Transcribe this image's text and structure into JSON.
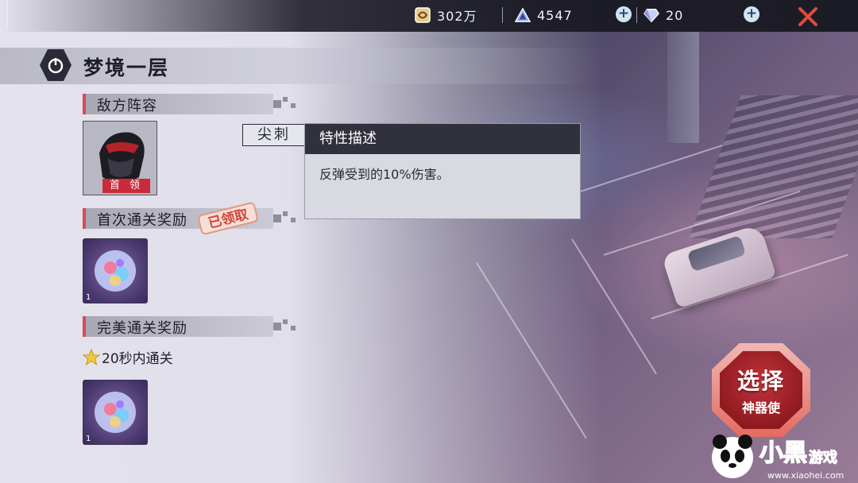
{
  "resources": {
    "gold": {
      "value": "302万",
      "icon": "coin-icon"
    },
    "energy": {
      "value": "4547",
      "icon": "energy-triangle-icon"
    },
    "diamond": {
      "value": "20",
      "icon": "diamond-icon"
    }
  },
  "title": "梦境一层",
  "sections": {
    "enemy": "敌方阵容",
    "first_clear": "首次通关奖励",
    "perfect_clear": "完美通关奖励"
  },
  "enemy": {
    "tag": "首 领"
  },
  "claimed_stamp": "已领取",
  "rewards": {
    "first_clear_count": "1",
    "perfect_clear_count": "1"
  },
  "perfect_condition": "20秒内通关",
  "trait": {
    "label": "尖刺"
  },
  "popup": {
    "title": "特性描述",
    "description": "反弹受到的10%伤害。"
  },
  "select_button": {
    "main": "选择",
    "sub": "神器使"
  },
  "watermark": {
    "brand": "小黑游戏",
    "url": "www.xiaohei.com"
  },
  "colors": {
    "accent_red": "#d94b55",
    "close": "#e34a3a",
    "popup_header": "#31313e",
    "select_button": "#c2333a"
  }
}
